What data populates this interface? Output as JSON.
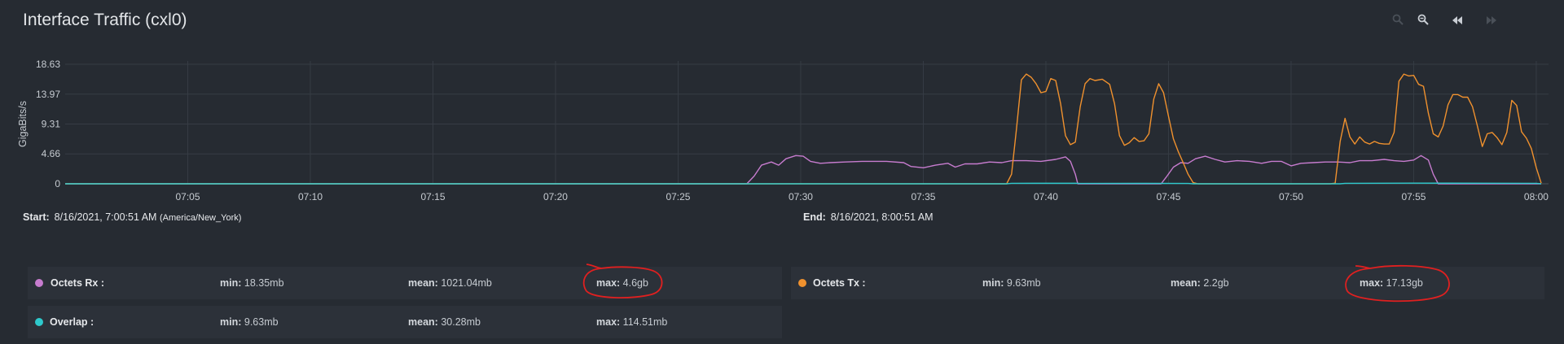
{
  "header": {
    "title": "Interface Traffic (cxl0)"
  },
  "toolbar": {
    "icons": [
      "zoom-in-icon",
      "zoom-out-icon",
      "rewind-icon",
      "fast-forward-icon"
    ]
  },
  "range": {
    "start_label": "Start:",
    "start_value": "8/16/2021, 7:00:51 AM",
    "start_tz": "(America/New_York)",
    "end_label": "End:",
    "end_value": "8/16/2021, 8:00:51 AM"
  },
  "legend": [
    {
      "name": "Octets Rx :",
      "color": "#c77ccf",
      "min_label": "min:",
      "min": "18.35mb",
      "mean_label": "mean:",
      "mean": "1021.04mb",
      "max_label": "max:",
      "max": "4.6gb",
      "circled": true
    },
    {
      "name": "Octets Tx :",
      "color": "#f0912e",
      "min_label": "min:",
      "min": "9.63mb",
      "mean_label": "mean:",
      "mean": "2.2gb",
      "max_label": "max:",
      "max": "17.13gb",
      "circled": true
    },
    {
      "name": "Overlap :",
      "color": "#2ec9cc",
      "min_label": "min:",
      "min": "9.63mb",
      "mean_label": "mean:",
      "mean": "30.28mb",
      "max_label": "max:",
      "max": "114.51mb",
      "circled": false
    }
  ],
  "colors": {
    "annotation": "#e02020",
    "grid": "#363c44"
  },
  "chart_data": {
    "type": "line",
    "ylabel": "GigaBits/s",
    "yticks": [
      "0",
      "4.66",
      "9.31",
      "13.97",
      "18.63"
    ],
    "ylim": [
      0,
      18.63
    ],
    "x_unit": "minutes past 07:00",
    "xticks": [
      "07:05",
      "07:10",
      "07:15",
      "07:20",
      "07:25",
      "07:30",
      "07:35",
      "07:40",
      "07:45",
      "07:50",
      "07:55",
      "08:00"
    ],
    "xtick_values": [
      5,
      10,
      15,
      20,
      25,
      30,
      35,
      40,
      45,
      50,
      55,
      60
    ],
    "xlim": [
      0,
      60.5
    ],
    "grid": true,
    "series": [
      {
        "name": "Octets Rx",
        "color": "#c77ccf",
        "points": [
          [
            0,
            0
          ],
          [
            27.8,
            0
          ],
          [
            28.1,
            1.2
          ],
          [
            28.4,
            2.9
          ],
          [
            28.8,
            3.4
          ],
          [
            29.1,
            2.9
          ],
          [
            29.4,
            3.9
          ],
          [
            29.8,
            4.4
          ],
          [
            30.1,
            4.3
          ],
          [
            30.4,
            3.5
          ],
          [
            30.8,
            3.2
          ],
          [
            31.2,
            3.3
          ],
          [
            31.8,
            3.4
          ],
          [
            32.5,
            3.5
          ],
          [
            33.5,
            3.5
          ],
          [
            34.2,
            3.3
          ],
          [
            34.5,
            2.7
          ],
          [
            35.0,
            2.5
          ],
          [
            35.5,
            2.9
          ],
          [
            36.0,
            3.2
          ],
          [
            36.3,
            2.6
          ],
          [
            36.7,
            3.1
          ],
          [
            37.2,
            3.1
          ],
          [
            37.7,
            3.4
          ],
          [
            38.2,
            3.3
          ],
          [
            38.6,
            3.6
          ],
          [
            39.2,
            3.6
          ],
          [
            39.8,
            3.5
          ],
          [
            40.4,
            3.8
          ],
          [
            40.8,
            4.2
          ],
          [
            41.0,
            3.5
          ],
          [
            41.2,
            1.5
          ],
          [
            41.3,
            0
          ],
          [
            44.7,
            0
          ],
          [
            44.9,
            1.0
          ],
          [
            45.2,
            2.6
          ],
          [
            45.5,
            3.3
          ],
          [
            45.8,
            3.2
          ],
          [
            46.1,
            3.9
          ],
          [
            46.5,
            4.3
          ],
          [
            46.9,
            3.8
          ],
          [
            47.3,
            3.4
          ],
          [
            47.8,
            3.6
          ],
          [
            48.3,
            3.5
          ],
          [
            48.8,
            3.2
          ],
          [
            49.2,
            3.5
          ],
          [
            49.6,
            3.5
          ],
          [
            50.0,
            2.8
          ],
          [
            50.4,
            3.2
          ],
          [
            50.9,
            3.3
          ],
          [
            51.4,
            3.4
          ],
          [
            51.9,
            3.4
          ],
          [
            52.4,
            3.3
          ],
          [
            52.8,
            3.6
          ],
          [
            53.3,
            3.6
          ],
          [
            53.8,
            3.8
          ],
          [
            54.2,
            3.6
          ],
          [
            54.6,
            3.5
          ],
          [
            55.0,
            3.7
          ],
          [
            55.3,
            4.4
          ],
          [
            55.6,
            3.7
          ],
          [
            55.8,
            1.5
          ],
          [
            56.0,
            0
          ],
          [
            60.2,
            0
          ]
        ]
      },
      {
        "name": "Octets Tx",
        "color": "#f0912e",
        "points": [
          [
            0,
            0
          ],
          [
            38.4,
            0
          ],
          [
            38.6,
            1.5
          ],
          [
            38.8,
            8.5
          ],
          [
            39.0,
            16.2
          ],
          [
            39.2,
            17.1
          ],
          [
            39.4,
            16.6
          ],
          [
            39.6,
            15.6
          ],
          [
            39.8,
            14.2
          ],
          [
            40.0,
            14.4
          ],
          [
            40.2,
            16.4
          ],
          [
            40.4,
            16.1
          ],
          [
            40.6,
            12.5
          ],
          [
            40.8,
            7.5
          ],
          [
            41.0,
            6.1
          ],
          [
            41.2,
            6.5
          ],
          [
            41.4,
            12.0
          ],
          [
            41.6,
            15.6
          ],
          [
            41.8,
            16.4
          ],
          [
            42.0,
            16.1
          ],
          [
            42.3,
            16.3
          ],
          [
            42.6,
            15.5
          ],
          [
            42.8,
            12.5
          ],
          [
            43.0,
            7.5
          ],
          [
            43.2,
            6.0
          ],
          [
            43.4,
            6.4
          ],
          [
            43.6,
            7.2
          ],
          [
            43.8,
            6.6
          ],
          [
            44.0,
            6.7
          ],
          [
            44.2,
            7.8
          ],
          [
            44.4,
            13.2
          ],
          [
            44.6,
            15.6
          ],
          [
            44.8,
            14.2
          ],
          [
            45.0,
            10.5
          ],
          [
            45.2,
            7.0
          ],
          [
            45.4,
            5.0
          ],
          [
            45.6,
            3.3
          ],
          [
            45.8,
            1.5
          ],
          [
            46.0,
            0.2
          ],
          [
            46.2,
            0
          ],
          [
            51.6,
            0
          ],
          [
            51.8,
            0.1
          ],
          [
            52.0,
            6.6
          ],
          [
            52.2,
            10.2
          ],
          [
            52.4,
            7.3
          ],
          [
            52.6,
            6.2
          ],
          [
            52.8,
            7.3
          ],
          [
            53.0,
            6.5
          ],
          [
            53.2,
            6.2
          ],
          [
            53.4,
            6.6
          ],
          [
            53.6,
            6.3
          ],
          [
            53.8,
            6.2
          ],
          [
            54.0,
            6.2
          ],
          [
            54.2,
            8.0
          ],
          [
            54.4,
            16.0
          ],
          [
            54.6,
            17.1
          ],
          [
            54.8,
            16.8
          ],
          [
            55.0,
            16.9
          ],
          [
            55.2,
            15.5
          ],
          [
            55.4,
            15.2
          ],
          [
            55.6,
            11.0
          ],
          [
            55.8,
            7.8
          ],
          [
            56.0,
            7.3
          ],
          [
            56.2,
            9.0
          ],
          [
            56.4,
            12.3
          ],
          [
            56.6,
            13.9
          ],
          [
            56.8,
            13.9
          ],
          [
            57.0,
            13.5
          ],
          [
            57.2,
            13.5
          ],
          [
            57.4,
            12.0
          ],
          [
            57.6,
            9.0
          ],
          [
            57.8,
            5.8
          ],
          [
            58.0,
            7.8
          ],
          [
            58.2,
            8.0
          ],
          [
            58.4,
            7.2
          ],
          [
            58.6,
            6.1
          ],
          [
            58.8,
            8.0
          ],
          [
            59.0,
            13.0
          ],
          [
            59.2,
            12.2
          ],
          [
            59.4,
            8.1
          ],
          [
            59.6,
            7.1
          ],
          [
            59.8,
            5.5
          ],
          [
            60.0,
            2.5
          ],
          [
            60.2,
            0.1
          ]
        ]
      },
      {
        "name": "Overlap",
        "color": "#2ec9cc",
        "points": [
          [
            0,
            0
          ],
          [
            38.4,
            0
          ],
          [
            38.6,
            0.08
          ],
          [
            41.2,
            0.09
          ],
          [
            41.4,
            0.05
          ],
          [
            44.0,
            0.06
          ],
          [
            45.8,
            0.05
          ],
          [
            46.0,
            0
          ],
          [
            52.0,
            0
          ],
          [
            52.2,
            0.08
          ],
          [
            55.0,
            0.1
          ],
          [
            58.0,
            0.09
          ],
          [
            60.0,
            0.08
          ],
          [
            60.2,
            0
          ]
        ]
      }
    ]
  }
}
